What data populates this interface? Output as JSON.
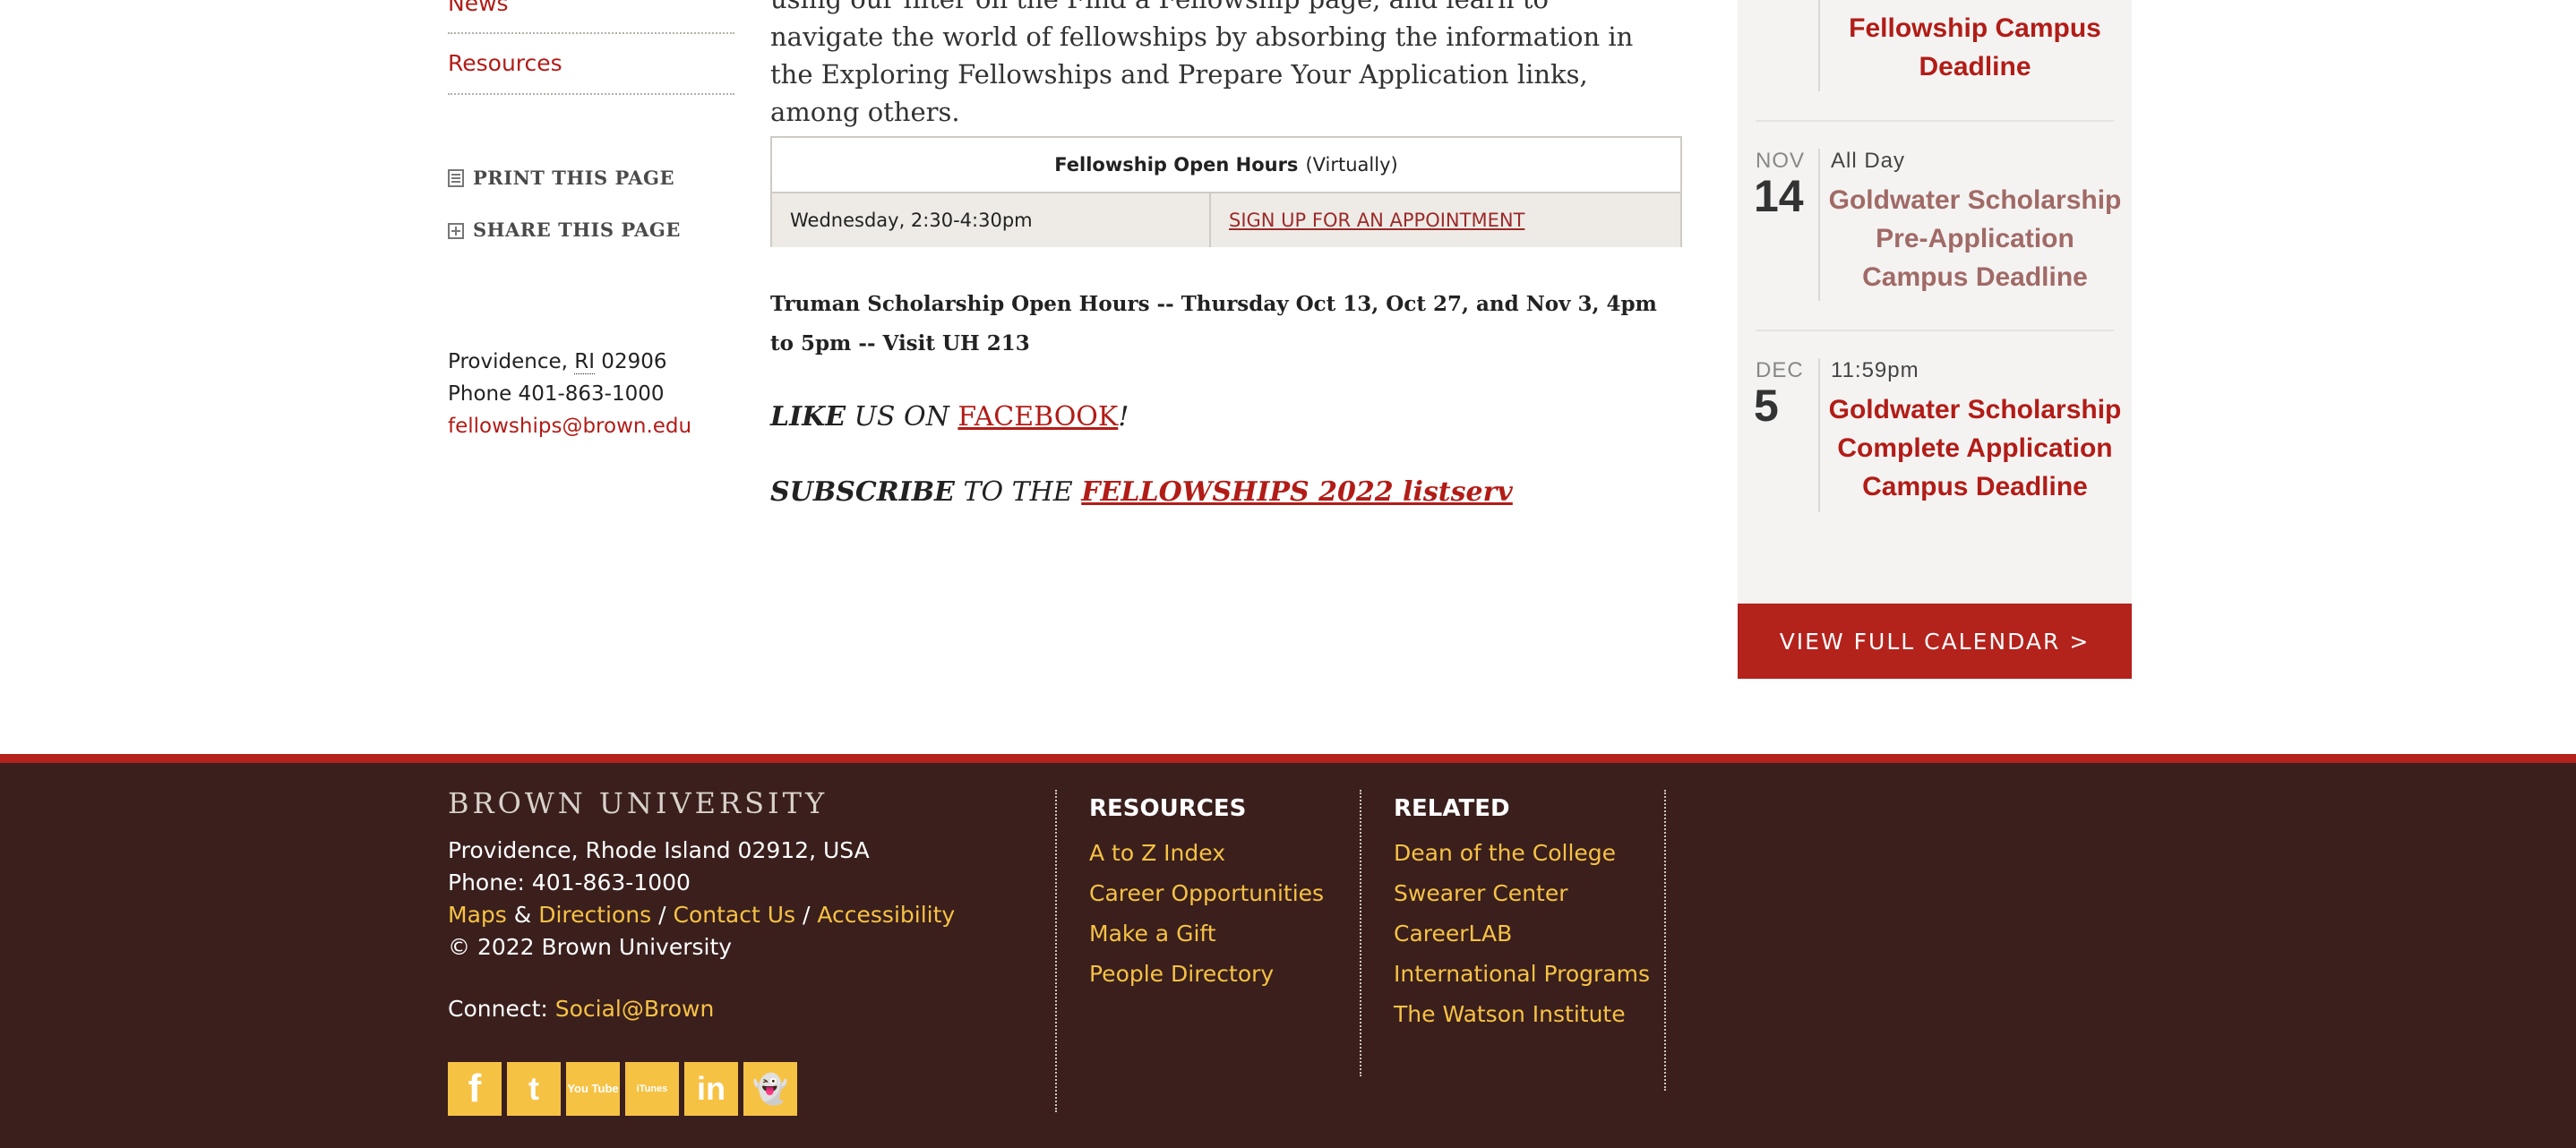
{
  "left": {
    "nav": [
      "News",
      "Resources"
    ],
    "tools": {
      "print": "Print This Page",
      "share": "Share This Page"
    },
    "address": {
      "city": "Providence, ",
      "state": "RI",
      "zip": " 02906",
      "phone": "Phone 401-863-1000",
      "email": "fellowships@brown.edu"
    }
  },
  "main": {
    "intro": "using our filter on the Find a Fellowship page, and learn to navigate the world of fellowships by absorbing the information in the Exploring Fellowships and Prepare Your Application links, among others.",
    "open_hours": {
      "title": "Fellowship Open Hours",
      "subtitle": "(Virtually)",
      "when": "Wednesday, 2:30-4:30pm",
      "link": "SIGN UP FOR AN APPOINTMENT"
    },
    "truman": "Truman Scholarship Open Hours -- Thursday Oct 13, Oct 27, and Nov 3, 4pm to 5pm -- Visit UH 213",
    "like": {
      "bold": "LIKE",
      "rest": " US ON ",
      "link": "FACEBOOK",
      "end": "!"
    },
    "subscribe": {
      "bold": "SUBSCRIBE",
      "rest": " TO THE ",
      "link": "FELLOWSHIPS 2022 listserv"
    }
  },
  "sidebar": {
    "events": [
      {
        "month": "",
        "day": "",
        "time": "",
        "title": "Fellowship Campus Deadline"
      },
      {
        "month": "NOV",
        "day": "14",
        "time": "All Day",
        "title": "Goldwater Scholarship Pre-Application Campus Deadline"
      },
      {
        "month": "DEC",
        "day": "5",
        "time": "11:59pm",
        "title": "Goldwater Scholarship Complete Application Campus Deadline"
      }
    ],
    "calendar_button": "VIEW FULL CALENDAR >"
  },
  "footer": {
    "brand": "BROWN UNIVERSITY",
    "address": "Providence, Rhode Island 02912, USA",
    "phone": "Phone: 401-863-1000",
    "links": {
      "maps": "Maps",
      "amp": " & ",
      "directions": "Directions",
      "slash1": " / ",
      "contact": "Contact Us",
      "slash2": " / ",
      "accessibility": "Accessibility"
    },
    "copyright": "© 2022 Brown University",
    "connect_label": "Connect: ",
    "connect_link": "Social@Brown",
    "social": [
      {
        "icon": "facebook-icon",
        "glyph": "f"
      },
      {
        "icon": "twitter-icon",
        "glyph": "t"
      },
      {
        "icon": "youtube-icon",
        "glyph": "You Tube"
      },
      {
        "icon": "itunes-icon",
        "glyph": "iTunes"
      },
      {
        "icon": "linkedin-icon",
        "glyph": "in"
      },
      {
        "icon": "snapchat-icon",
        "glyph": "👻"
      }
    ],
    "resources": {
      "heading": "RESOURCES",
      "items": [
        "A to Z Index",
        "Career Opportunities",
        "Make a Gift",
        "People Directory"
      ]
    },
    "related": {
      "heading": "RELATED",
      "items": [
        "Dean of the College",
        "Swearer Center",
        "CareerLAB",
        "International Programs",
        "The Watson Institute"
      ]
    }
  },
  "colors": {
    "accent": "#b21c17",
    "footer_bg": "#3a1f1d",
    "footer_link": "#f6c244",
    "sidebar_bg": "#f4f3f2"
  }
}
